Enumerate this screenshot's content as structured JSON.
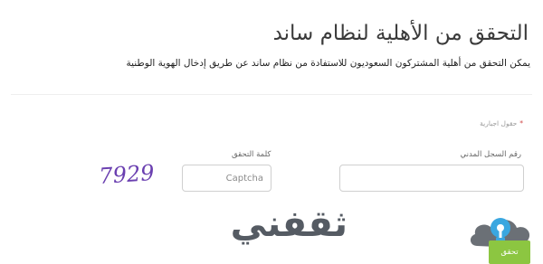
{
  "page": {
    "title": "التحقق من الأهلية لنظام ساند",
    "subtitle": "يمكن التحقق من أهلية المشتركون السعوديون للاستفادة من نظام ساند عن طريق إدخال الهوية الوطنية"
  },
  "form": {
    "required_note": "حقول اجبارية",
    "national_id_label": "رقم السجل المدني",
    "national_id_value": "",
    "captcha_label": "كلمة التحقق",
    "captcha_placeholder": "Captcha",
    "captcha_image_text": "7929",
    "submit_label": "تحقق"
  },
  "watermark": {
    "text": "ثقفني",
    "icon": "lightbulb-icon"
  },
  "colors": {
    "submit_button": "#8cc641",
    "captcha_ink": "#6a3fb0",
    "required_star": "#d04848",
    "watermark_text": "#555b63",
    "watermark_bulb": "#3aa7e0"
  }
}
